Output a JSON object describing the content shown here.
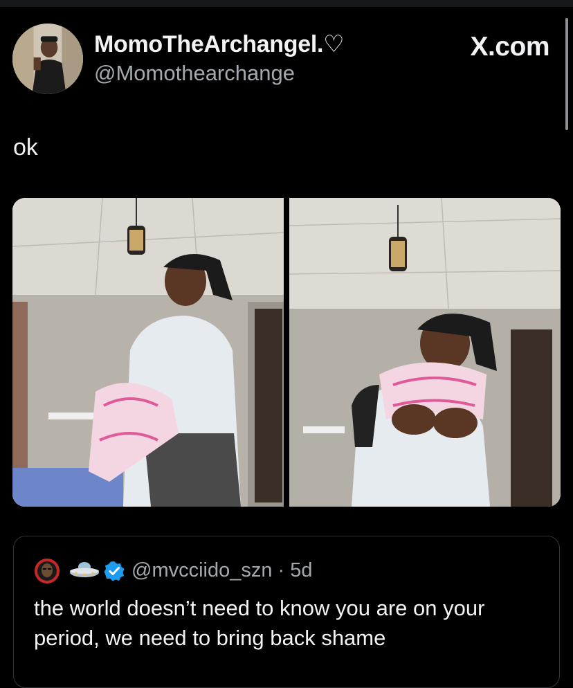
{
  "header": {
    "display_name": "MomoTheArchangel.♡",
    "handle": "@Momothearchange",
    "source_logo": "X.com"
  },
  "tweet": {
    "text": "ok"
  },
  "media": {
    "count": 2
  },
  "quote": {
    "avatar_icon": "avatar-icon",
    "emoji_icon": "flying-saucer-icon",
    "verified_icon": "verified-badge-icon",
    "handle": "@mvcciido_szn",
    "separator": "·",
    "age": "5d",
    "handle_line": "@mvcciido_szn · 5d",
    "text": "the world doesn’t need to know you are on your period, we need to bring back shame"
  },
  "colors": {
    "background": "#000000",
    "primary_text": "#f1f3f4",
    "secondary_text": "#a3a9ae",
    "border": "#333639",
    "verified_blue": "#1d9bf0"
  }
}
